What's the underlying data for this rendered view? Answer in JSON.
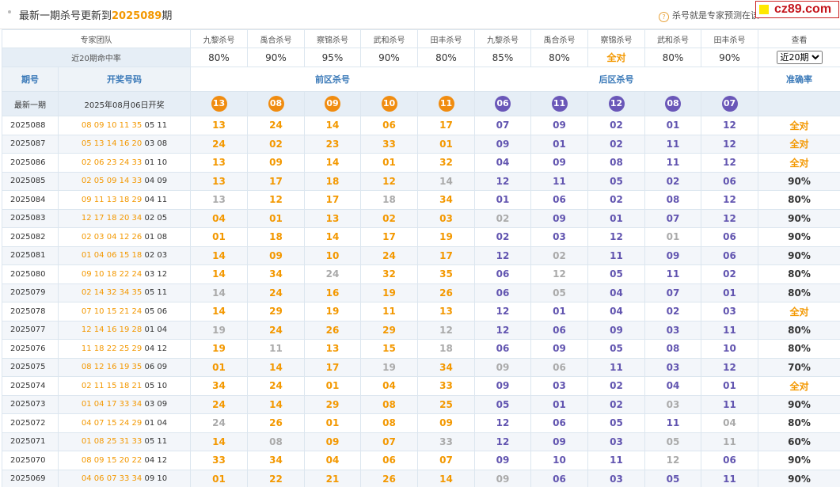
{
  "header": {
    "title_prefix": "最新一期杀号更新到",
    "title_period": "2025089",
    "title_suffix": "期",
    "hint_icon": "question-icon",
    "hint": "杀号就是专家预测在该",
    "brand": "cz89.com"
  },
  "experts_label": "专家团队",
  "experts": [
    "九黎杀号",
    "禹合杀号",
    "察锦杀号",
    "武和杀号",
    "田丰杀号",
    "九黎杀号",
    "禹合杀号",
    "察锦杀号",
    "武和杀号",
    "田丰杀号"
  ],
  "view_label": "查看",
  "rate_label": "近20期命中率",
  "rates": [
    "80%",
    "90%",
    "95%",
    "90%",
    "80%",
    "85%",
    "80%",
    "全对",
    "80%",
    "90%"
  ],
  "view_select": "近20期",
  "columns": {
    "period": "期号",
    "draw": "开奖号码",
    "front": "前区杀号",
    "back": "后区杀号",
    "accuracy": "准确率"
  },
  "latest": {
    "label": "最新一期",
    "draw": "2025年08月06日开奖",
    "front": [
      "13",
      "08",
      "09",
      "10",
      "11"
    ],
    "back": [
      "06",
      "11",
      "12",
      "08",
      "07"
    ]
  },
  "rows": [
    {
      "p": "2025088",
      "r": [
        "08",
        "09",
        "10",
        "11",
        "35"
      ],
      "b": [
        "05",
        "11"
      ],
      "f": [
        "13",
        "24",
        "14",
        "06",
        "17"
      ],
      "k": [
        "07",
        "09",
        "02",
        "01",
        "12"
      ],
      "a": "全对"
    },
    {
      "p": "2025087",
      "r": [
        "05",
        "13",
        "14",
        "16",
        "20"
      ],
      "b": [
        "03",
        "08"
      ],
      "f": [
        "24",
        "02",
        "23",
        "33",
        "01"
      ],
      "k": [
        "09",
        "01",
        "02",
        "11",
        "12"
      ],
      "a": "全对"
    },
    {
      "p": "2025086",
      "r": [
        "02",
        "06",
        "23",
        "24",
        "33"
      ],
      "b": [
        "01",
        "10"
      ],
      "f": [
        "13",
        "09",
        "14",
        "01",
        "32"
      ],
      "k": [
        "04",
        "09",
        "08",
        "11",
        "12"
      ],
      "a": "全对"
    },
    {
      "p": "2025085",
      "r": [
        "02",
        "05",
        "09",
        "14",
        "33"
      ],
      "b": [
        "04",
        "09"
      ],
      "f": [
        "13",
        "17",
        "18",
        "12",
        "14"
      ],
      "k": [
        "12",
        "11",
        "05",
        "02",
        "06"
      ],
      "a": "90%"
    },
    {
      "p": "2025084",
      "r": [
        "09",
        "11",
        "13",
        "18",
        "29"
      ],
      "b": [
        "04",
        "11"
      ],
      "f": [
        "13",
        "12",
        "17",
        "18",
        "34"
      ],
      "k": [
        "01",
        "06",
        "02",
        "08",
        "12"
      ],
      "a": "80%"
    },
    {
      "p": "2025083",
      "r": [
        "12",
        "17",
        "18",
        "20",
        "34"
      ],
      "b": [
        "02",
        "05"
      ],
      "f": [
        "04",
        "01",
        "13",
        "02",
        "03"
      ],
      "k": [
        "02",
        "09",
        "01",
        "07",
        "12"
      ],
      "a": "90%"
    },
    {
      "p": "2025082",
      "r": [
        "02",
        "03",
        "04",
        "12",
        "26"
      ],
      "b": [
        "01",
        "08"
      ],
      "f": [
        "01",
        "18",
        "14",
        "17",
        "19"
      ],
      "k": [
        "02",
        "03",
        "12",
        "01",
        "06"
      ],
      "a": "90%"
    },
    {
      "p": "2025081",
      "r": [
        "01",
        "04",
        "06",
        "15",
        "18"
      ],
      "b": [
        "02",
        "03"
      ],
      "f": [
        "14",
        "09",
        "10",
        "24",
        "17"
      ],
      "k": [
        "12",
        "02",
        "11",
        "09",
        "06"
      ],
      "a": "90%"
    },
    {
      "p": "2025080",
      "r": [
        "09",
        "10",
        "18",
        "22",
        "24"
      ],
      "b": [
        "03",
        "12"
      ],
      "f": [
        "14",
        "34",
        "24",
        "32",
        "35"
      ],
      "k": [
        "06",
        "12",
        "05",
        "11",
        "02"
      ],
      "a": "80%"
    },
    {
      "p": "2025079",
      "r": [
        "02",
        "14",
        "32",
        "34",
        "35"
      ],
      "b": [
        "05",
        "11"
      ],
      "f": [
        "14",
        "24",
        "16",
        "19",
        "26"
      ],
      "k": [
        "06",
        "05",
        "04",
        "07",
        "01"
      ],
      "a": "80%"
    },
    {
      "p": "2025078",
      "r": [
        "07",
        "10",
        "15",
        "21",
        "24"
      ],
      "b": [
        "05",
        "06"
      ],
      "f": [
        "14",
        "29",
        "19",
        "11",
        "13"
      ],
      "k": [
        "12",
        "01",
        "04",
        "02",
        "03"
      ],
      "a": "全对"
    },
    {
      "p": "2025077",
      "r": [
        "12",
        "14",
        "16",
        "19",
        "28"
      ],
      "b": [
        "01",
        "04"
      ],
      "f": [
        "19",
        "24",
        "26",
        "29",
        "12"
      ],
      "k": [
        "12",
        "06",
        "09",
        "03",
        "11"
      ],
      "a": "80%"
    },
    {
      "p": "2025076",
      "r": [
        "11",
        "18",
        "22",
        "25",
        "29"
      ],
      "b": [
        "04",
        "12"
      ],
      "f": [
        "19",
        "11",
        "13",
        "15",
        "18"
      ],
      "k": [
        "06",
        "09",
        "05",
        "08",
        "10"
      ],
      "a": "80%"
    },
    {
      "p": "2025075",
      "r": [
        "08",
        "12",
        "16",
        "19",
        "35"
      ],
      "b": [
        "06",
        "09"
      ],
      "f": [
        "01",
        "14",
        "17",
        "19",
        "34"
      ],
      "k": [
        "09",
        "06",
        "11",
        "03",
        "12"
      ],
      "a": "70%"
    },
    {
      "p": "2025074",
      "r": [
        "02",
        "11",
        "15",
        "18",
        "21"
      ],
      "b": [
        "05",
        "10"
      ],
      "f": [
        "34",
        "24",
        "01",
        "04",
        "33"
      ],
      "k": [
        "09",
        "03",
        "02",
        "04",
        "01"
      ],
      "a": "全对"
    },
    {
      "p": "2025073",
      "r": [
        "01",
        "04",
        "17",
        "33",
        "34"
      ],
      "b": [
        "03",
        "09"
      ],
      "f": [
        "24",
        "14",
        "29",
        "08",
        "25"
      ],
      "k": [
        "05",
        "01",
        "02",
        "03",
        "11"
      ],
      "a": "90%"
    },
    {
      "p": "2025072",
      "r": [
        "04",
        "07",
        "15",
        "24",
        "29"
      ],
      "b": [
        "01",
        "04"
      ],
      "f": [
        "24",
        "26",
        "01",
        "08",
        "09"
      ],
      "k": [
        "12",
        "06",
        "05",
        "11",
        "04"
      ],
      "a": "80%"
    },
    {
      "p": "2025071",
      "r": [
        "01",
        "08",
        "25",
        "31",
        "33"
      ],
      "b": [
        "05",
        "11"
      ],
      "f": [
        "14",
        "08",
        "09",
        "07",
        "33"
      ],
      "k": [
        "12",
        "09",
        "03",
        "05",
        "11"
      ],
      "a": "60%"
    },
    {
      "p": "2025070",
      "r": [
        "08",
        "09",
        "15",
        "20",
        "22"
      ],
      "b": [
        "04",
        "12"
      ],
      "f": [
        "33",
        "34",
        "04",
        "06",
        "07"
      ],
      "k": [
        "09",
        "10",
        "11",
        "12",
        "06"
      ],
      "a": "90%"
    },
    {
      "p": "2025069",
      "r": [
        "04",
        "06",
        "07",
        "33",
        "34"
      ],
      "b": [
        "09",
        "10"
      ],
      "f": [
        "01",
        "22",
        "21",
        "26",
        "14"
      ],
      "k": [
        "09",
        "06",
        "03",
        "05",
        "11"
      ],
      "a": "90%"
    }
  ],
  "colors": {
    "front": "#f39800",
    "back": "#6255b0",
    "miss": "#aaaaaa",
    "header": "#3a79b8"
  }
}
